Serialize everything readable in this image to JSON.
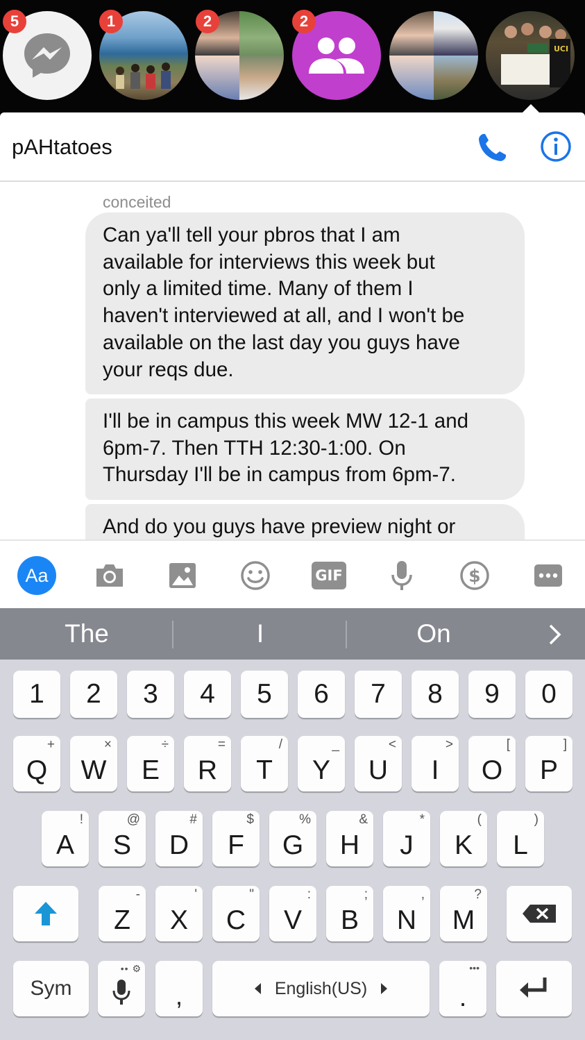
{
  "chat_heads": [
    {
      "badge": "5",
      "kind": "messenger-logo"
    },
    {
      "badge": "1",
      "kind": "photo-coast"
    },
    {
      "badge": "2",
      "kind": "photo-group-quad"
    },
    {
      "badge": "2",
      "kind": "group-icon"
    },
    {
      "badge": "",
      "kind": "photo-quad-2"
    },
    {
      "badge": "",
      "kind": "photo-group-sign"
    }
  ],
  "header": {
    "title": "pAHtatoes",
    "call_icon": "phone-icon",
    "info_icon": "info-icon"
  },
  "conversation": {
    "sender": "conceited",
    "messages": [
      "Can ya'll tell your pbros that I am\navailable for interviews this week but\nonly a limited time. Many of them I\nhaven't interviewed at all, and I won't be\navailable on the last day you guys have\nyour reqs due.",
      "I'll be in campus this week MW 12-1 and\n6pm-7. Then TTH 12:30-1:00. On\nThursday I'll be in campus from 6pm-7.",
      "And do you guys have preview night or"
    ]
  },
  "composer": {
    "aa_label": "Aa",
    "tools": [
      "camera-icon",
      "gallery-icon",
      "emoji-icon",
      "gif-icon",
      "microphone-icon",
      "payment-icon",
      "more-icon"
    ],
    "gif_label": "GIF"
  },
  "keyboard": {
    "suggestions": [
      "The",
      "I",
      "On"
    ],
    "number_row": [
      "1",
      "2",
      "3",
      "4",
      "5",
      "6",
      "7",
      "8",
      "9",
      "0"
    ],
    "row1": [
      {
        "k": "Q",
        "a": "+"
      },
      {
        "k": "W",
        "a": "×"
      },
      {
        "k": "E",
        "a": "÷"
      },
      {
        "k": "R",
        "a": "="
      },
      {
        "k": "T",
        "a": "/"
      },
      {
        "k": "Y",
        "a": "_"
      },
      {
        "k": "U",
        "a": "<"
      },
      {
        "k": "I",
        "a": ">"
      },
      {
        "k": "O",
        "a": "["
      },
      {
        "k": "P",
        "a": "]"
      }
    ],
    "row2": [
      {
        "k": "A",
        "a": "!"
      },
      {
        "k": "S",
        "a": "@"
      },
      {
        "k": "D",
        "a": "#"
      },
      {
        "k": "F",
        "a": "$"
      },
      {
        "k": "G",
        "a": "%"
      },
      {
        "k": "H",
        "a": "&"
      },
      {
        "k": "J",
        "a": "*"
      },
      {
        "k": "K",
        "a": "("
      },
      {
        "k": "L",
        "a": ")"
      }
    ],
    "row3": [
      {
        "k": "Z",
        "a": "-"
      },
      {
        "k": "X",
        "a": "'"
      },
      {
        "k": "C",
        "a": "\""
      },
      {
        "k": "V",
        "a": ":"
      },
      {
        "k": "B",
        "a": ";"
      },
      {
        "k": "N",
        "a": ","
      },
      {
        "k": "M",
        "a": "?"
      }
    ],
    "sym_label": "Sym",
    "comma": ",",
    "space_label": "English(US)",
    "period": ".",
    "period_alt": "•••"
  }
}
